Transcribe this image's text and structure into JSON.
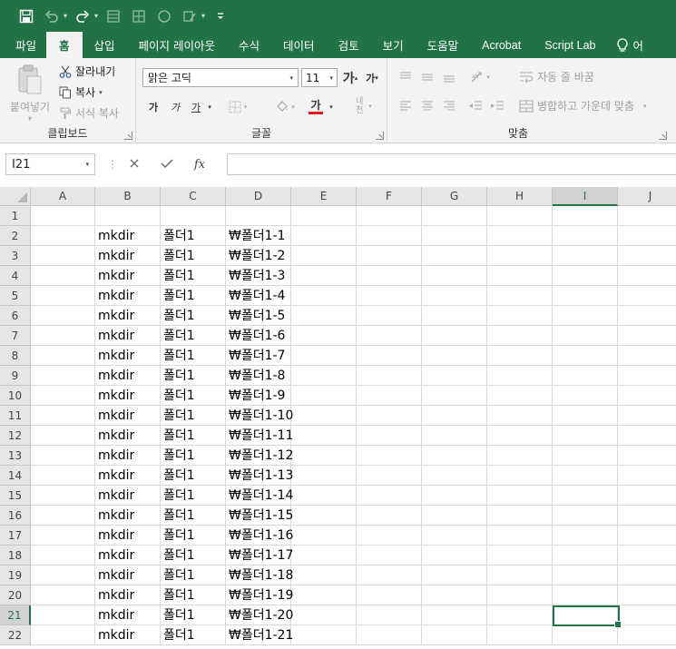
{
  "ribbon_tabs": [
    "파일",
    "홈",
    "삽입",
    "페이지 레이아웃",
    "수식",
    "데이터",
    "검토",
    "보기",
    "도움말",
    "Acrobat",
    "Script Lab"
  ],
  "active_tab": "홈",
  "tell_me_partial": "어",
  "clipboard": {
    "paste_label": "붙여넣기",
    "cut_label": "잘라내기",
    "copy_label": "복사",
    "format_painter_label": "서식 복사",
    "group_label": "클립보드"
  },
  "font": {
    "family": "맑은 고딕",
    "size": "11",
    "grow_label": "가",
    "shrink_label": "가",
    "bold_label": "가",
    "italic_label": "가",
    "underline_label": "가",
    "font_color_label": "가",
    "phonetic_label": "내천",
    "group_label": "글꼴",
    "font_color": "#e21b1b"
  },
  "alignment": {
    "wrap_text_label": "자동 줄 바꿈",
    "merge_center_label": "병합하고 가운데 맞춤",
    "group_label": "맞춤"
  },
  "name_box": "I21",
  "formula": "",
  "columns": [
    "A",
    "B",
    "C",
    "D",
    "E",
    "F",
    "G",
    "H",
    "I",
    "J"
  ],
  "selected_column": "I",
  "selected_row": "21",
  "rows": [
    {
      "num": "1",
      "B": "",
      "C": "",
      "D": ""
    },
    {
      "num": "2",
      "B": "mkdir",
      "C": "폴더1",
      "D": "₩폴더1-1"
    },
    {
      "num": "3",
      "B": "mkdir",
      "C": "폴더1",
      "D": "₩폴더1-2"
    },
    {
      "num": "4",
      "B": "mkdir",
      "C": "폴더1",
      "D": "₩폴더1-3"
    },
    {
      "num": "5",
      "B": "mkdir",
      "C": "폴더1",
      "D": "₩폴더1-4"
    },
    {
      "num": "6",
      "B": "mkdir",
      "C": "폴더1",
      "D": "₩폴더1-5"
    },
    {
      "num": "7",
      "B": "mkdir",
      "C": "폴더1",
      "D": "₩폴더1-6"
    },
    {
      "num": "8",
      "B": "mkdir",
      "C": "폴더1",
      "D": "₩폴더1-7"
    },
    {
      "num": "9",
      "B": "mkdir",
      "C": "폴더1",
      "D": "₩폴더1-8"
    },
    {
      "num": "10",
      "B": "mkdir",
      "C": "폴더1",
      "D": "₩폴더1-9"
    },
    {
      "num": "11",
      "B": "mkdir",
      "C": "폴더1",
      "D": "₩폴더1-10"
    },
    {
      "num": "12",
      "B": "mkdir",
      "C": "폴더1",
      "D": "₩폴더1-11"
    },
    {
      "num": "13",
      "B": "mkdir",
      "C": "폴더1",
      "D": "₩폴더1-12"
    },
    {
      "num": "14",
      "B": "mkdir",
      "C": "폴더1",
      "D": "₩폴더1-13"
    },
    {
      "num": "15",
      "B": "mkdir",
      "C": "폴더1",
      "D": "₩폴더1-14"
    },
    {
      "num": "16",
      "B": "mkdir",
      "C": "폴더1",
      "D": "₩폴더1-15"
    },
    {
      "num": "17",
      "B": "mkdir",
      "C": "폴더1",
      "D": "₩폴더1-16"
    },
    {
      "num": "18",
      "B": "mkdir",
      "C": "폴더1",
      "D": "₩폴더1-17"
    },
    {
      "num": "19",
      "B": "mkdir",
      "C": "폴더1",
      "D": "₩폴더1-18"
    },
    {
      "num": "20",
      "B": "mkdir",
      "C": "폴더1",
      "D": "₩폴더1-19"
    },
    {
      "num": "21",
      "B": "mkdir",
      "C": "폴더1",
      "D": "₩폴더1-20"
    },
    {
      "num": "22",
      "B": "mkdir",
      "C": "폴더1",
      "D": "₩폴더1-21"
    }
  ],
  "colors": {
    "brand": "#217346",
    "grid_line": "#dadada",
    "header_bg": "#e6e6e6"
  }
}
